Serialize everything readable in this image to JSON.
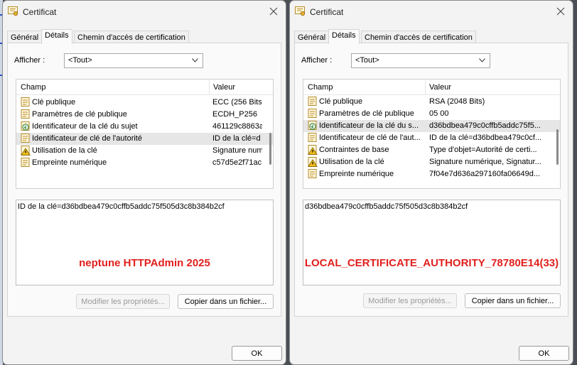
{
  "window_a": {
    "title": "Certificat",
    "tabs": [
      "Général",
      "Détails",
      "Chemin d'accès de certification"
    ],
    "show_label": "Afficher :",
    "show_value": "<Tout>",
    "columns": {
      "field": "Champ",
      "value": "Valeur"
    },
    "rows": [
      {
        "field": "Clé publique",
        "value": "ECC (256 Bits)",
        "icon": "cert-doc-icon"
      },
      {
        "field": "Paramètres de clé publique",
        "value": "ECDH_P256",
        "icon": "cert-doc-icon"
      },
      {
        "field": "Identificateur de la clé du sujet",
        "value": "461129c8863a",
        "icon": "cert-ext-icon"
      },
      {
        "field": "Identificateur de clé de l'autorité",
        "value": "ID de la clé=d",
        "icon": "cert-doc-icon",
        "selected": true
      },
      {
        "field": "Utilisation de la clé",
        "value": "Signature num",
        "icon": "cert-warning-icon"
      },
      {
        "field": "Empreinte numérique",
        "value": "c57d5e2f71ac",
        "icon": "cert-doc-icon"
      }
    ],
    "detail_text": "ID de la clé=d36bdbea479c0cffb5addc75f505d3c8b384b2cf",
    "annotation": "neptune HTTPAdmin 2025",
    "annotation_color": "#e0201d",
    "edit_button": "Modifier les propriétés...",
    "copy_button": "Copier dans un fichier...",
    "ok_button": "OK"
  },
  "window_b": {
    "title": "Certificat",
    "tabs": [
      "Général",
      "Détails",
      "Chemin d'accès de certification"
    ],
    "show_label": "Afficher :",
    "show_value": "<Tout>",
    "columns": {
      "field": "Champ",
      "value": "Valeur"
    },
    "rows": [
      {
        "field": "Clé publique",
        "value": "RSA (2048 Bits)",
        "icon": "cert-doc-icon"
      },
      {
        "field": "Paramètres de clé publique",
        "value": "05 00",
        "icon": "cert-doc-icon"
      },
      {
        "field": "Identificateur de la clé du s...",
        "value": "d36bdbea479c0cffb5addc75f5...",
        "icon": "cert-ext-icon",
        "selected": true
      },
      {
        "field": "Identificateur de clé de l'aut...",
        "value": "ID de la clé=d36bdbea479c0cf...",
        "icon": "cert-doc-icon"
      },
      {
        "field": "Contraintes de base",
        "value": "Type d'objet=Autorité de certi...",
        "icon": "cert-warning-icon"
      },
      {
        "field": "Utilisation de la clé",
        "value": "Signature numérique, Signatur...",
        "icon": "cert-warning-icon"
      },
      {
        "field": "Empreinte numérique",
        "value": "7f04e7d636a297160fa06649d...",
        "icon": "cert-doc-icon"
      }
    ],
    "detail_text": "d36bdbea479c0cffb5addc75f505d3c8b384b2cf",
    "annotation": "LOCAL_CERTIFICATE_AUTHORITY_78780E14(33)",
    "annotation_color": "#e0201d",
    "edit_button": "Modifier les propriétés...",
    "copy_button": "Copier dans un fichier...",
    "ok_button": "OK"
  }
}
